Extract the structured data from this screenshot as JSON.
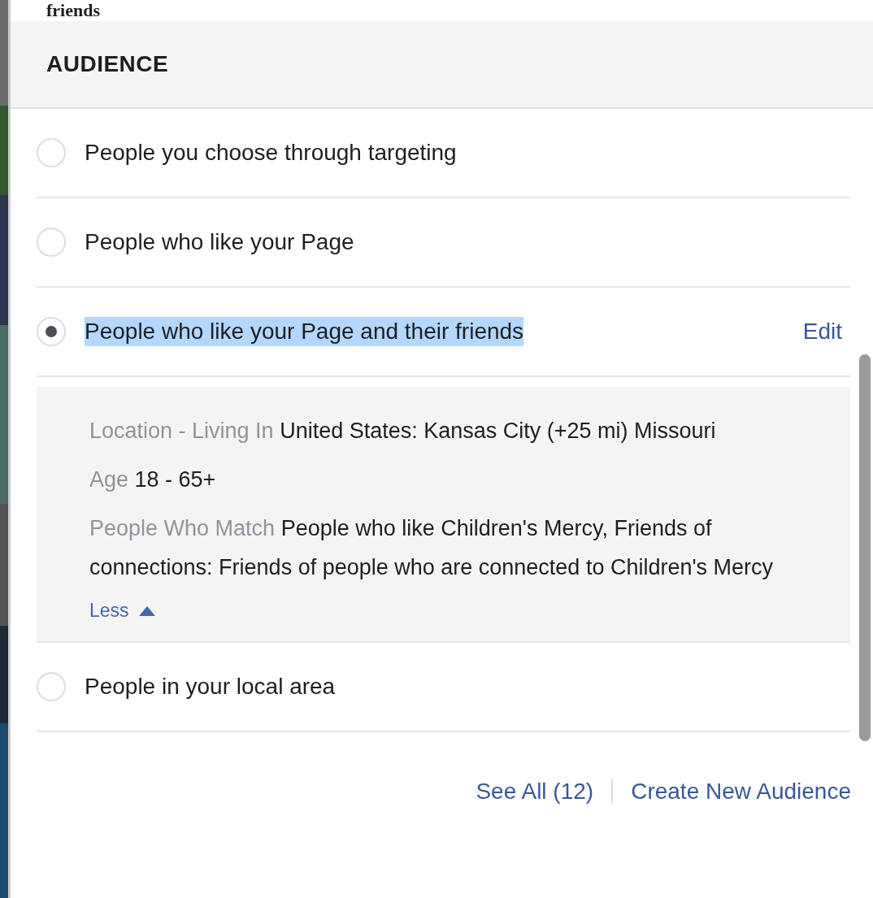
{
  "top_text": "friends",
  "header": {
    "title": "AUDIENCE"
  },
  "options": [
    {
      "label": "People you choose through targeting",
      "selected": false
    },
    {
      "label": "People who like your Page",
      "selected": false
    },
    {
      "label": "People who like your Page and their friends",
      "selected": true,
      "highlighted": true,
      "action": "Edit",
      "expanded": true,
      "details": [
        {
          "label": "Location - Living In",
          "value": "United States: Kansas City (+25 mi) Missouri"
        },
        {
          "label": "Age",
          "value": "18 - 65+"
        },
        {
          "label": "People Who Match",
          "value": "People who like Children's Mercy, Friends of connections: Friends of people who are connected to Children's Mercy"
        }
      ],
      "toggle": "Less"
    },
    {
      "label": "People in your local area",
      "selected": false
    }
  ],
  "footer_links": [
    "See All (12)",
    "Create New Audience"
  ]
}
